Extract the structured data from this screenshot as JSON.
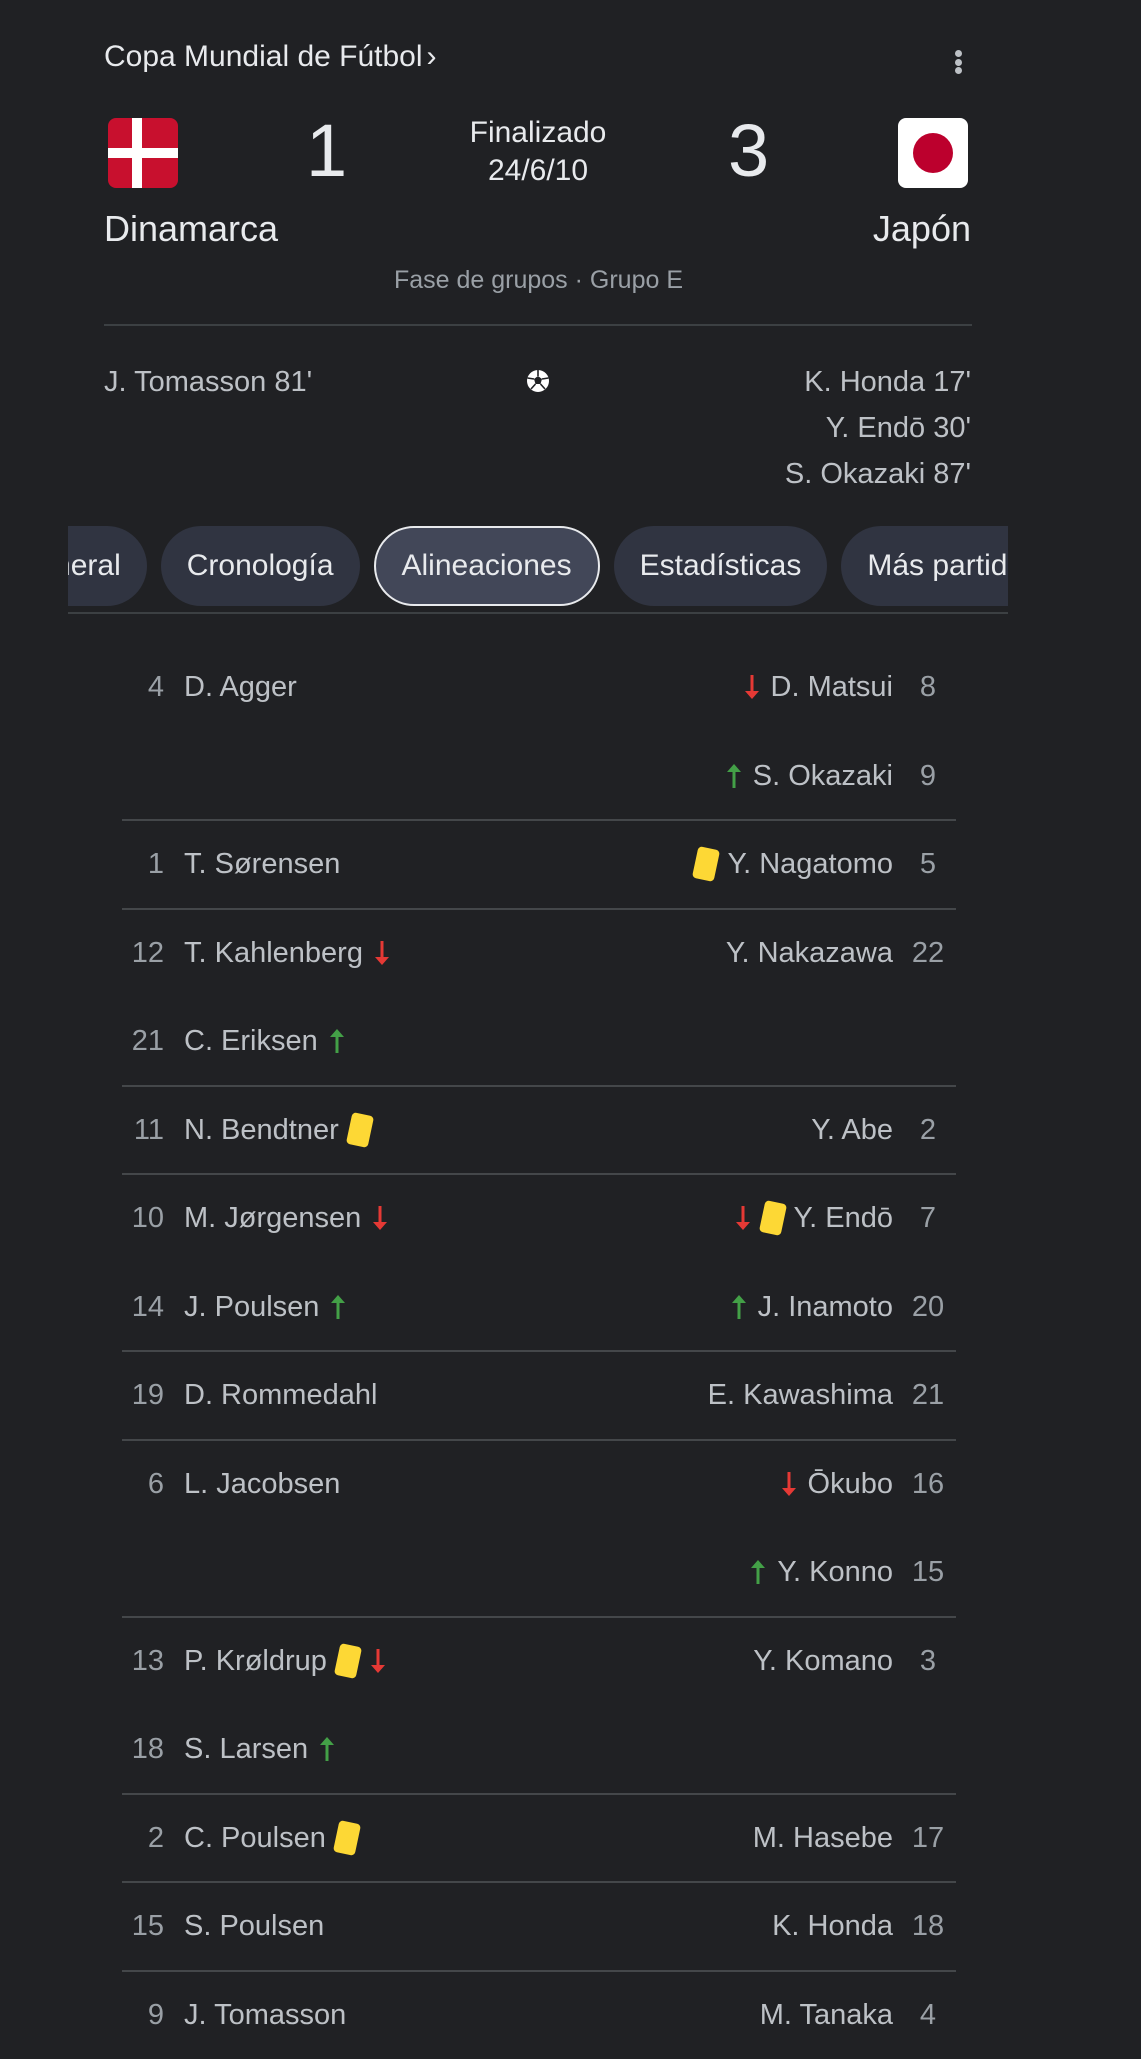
{
  "header": {
    "competition": "Copa Mundial de Fútbol",
    "competition_chevron": "›"
  },
  "match": {
    "home_team": "Dinamarca",
    "away_team": "Japón",
    "home_score": "1",
    "away_score": "3",
    "status": "Finalizado",
    "date": "24/6/10",
    "stage": "Fase de grupos · Grupo E",
    "home_flag": "denmark-flag",
    "away_flag": "japan-flag"
  },
  "scorers": {
    "home": [
      "J. Tomasson 81'"
    ],
    "away": [
      "K. Honda 17'",
      "Y. Endō 30'",
      "S. Okazaki 87'"
    ],
    "icon": "soccer-ball-icon"
  },
  "tabs": [
    {
      "label": "General"
    },
    {
      "label": "Cronología"
    },
    {
      "label": "Alineaciones",
      "active": true
    },
    {
      "label": "Estadísticas"
    },
    {
      "label": "Más partidos"
    }
  ],
  "colors": {
    "background": "#202124",
    "card_yellow": "#fdd835",
    "sub_out": "#e53935",
    "sub_in": "#43a047"
  },
  "lineup": [
    {
      "home": {
        "num": "4",
        "name": "D. Agger",
        "icons": []
      },
      "away": {
        "num": "8",
        "name": "D. Matsui",
        "icons": [
          "sub-out"
        ]
      }
    },
    {
      "home": null,
      "away": {
        "num": "9",
        "name": "S. Okazaki",
        "icons": [
          "sub-in"
        ]
      }
    },
    {
      "home": {
        "num": "1",
        "name": "T. Sørensen",
        "icons": []
      },
      "away": {
        "num": "5",
        "name": "Y. Nagatomo",
        "icons": [
          "yellow-card"
        ]
      }
    },
    {
      "home": {
        "num": "12",
        "name": "T. Kahlenberg",
        "icons": [
          "sub-out"
        ]
      },
      "away": {
        "num": "22",
        "name": "Y. Nakazawa",
        "icons": []
      }
    },
    {
      "home": {
        "num": "21",
        "name": "C. Eriksen",
        "icons": [
          "sub-in"
        ]
      },
      "away": null
    },
    {
      "home": {
        "num": "11",
        "name": "N. Bendtner",
        "icons": [
          "yellow-card"
        ]
      },
      "away": {
        "num": "2",
        "name": "Y. Abe",
        "icons": []
      }
    },
    {
      "home": {
        "num": "10",
        "name": "M. Jørgensen",
        "icons": [
          "sub-out"
        ]
      },
      "away": {
        "num": "7",
        "name": "Y. Endō",
        "icons": [
          "sub-out",
          "yellow-card"
        ]
      }
    },
    {
      "home": {
        "num": "14",
        "name": "J. Poulsen",
        "icons": [
          "sub-in"
        ]
      },
      "away": {
        "num": "20",
        "name": "J. Inamoto",
        "icons": [
          "sub-in"
        ]
      }
    },
    {
      "home": {
        "num": "19",
        "name": "D. Rommedahl",
        "icons": []
      },
      "away": {
        "num": "21",
        "name": "E. Kawashima",
        "icons": []
      }
    },
    {
      "home": {
        "num": "6",
        "name": "L. Jacobsen",
        "icons": []
      },
      "away": {
        "num": "16",
        "name": "Ōkubo",
        "icons": [
          "sub-out"
        ]
      }
    },
    {
      "home": null,
      "away": {
        "num": "15",
        "name": "Y. Konno",
        "icons": [
          "sub-in"
        ]
      }
    },
    {
      "home": {
        "num": "13",
        "name": "P. Krøldrup",
        "icons": [
          "yellow-card",
          "sub-out"
        ]
      },
      "away": {
        "num": "3",
        "name": "Y. Komano",
        "icons": []
      }
    },
    {
      "home": {
        "num": "18",
        "name": "S. Larsen",
        "icons": [
          "sub-in"
        ]
      },
      "away": null
    },
    {
      "home": {
        "num": "2",
        "name": "C. Poulsen",
        "icons": [
          "yellow-card"
        ]
      },
      "away": {
        "num": "17",
        "name": "M. Hasebe",
        "icons": []
      }
    },
    {
      "home": {
        "num": "15",
        "name": "S. Poulsen",
        "icons": []
      },
      "away": {
        "num": "18",
        "name": "K. Honda",
        "icons": []
      }
    },
    {
      "home": {
        "num": "9",
        "name": "J. Tomasson",
        "icons": []
      },
      "away": {
        "num": "4",
        "name": "M. Tanaka",
        "icons": []
      }
    }
  ]
}
